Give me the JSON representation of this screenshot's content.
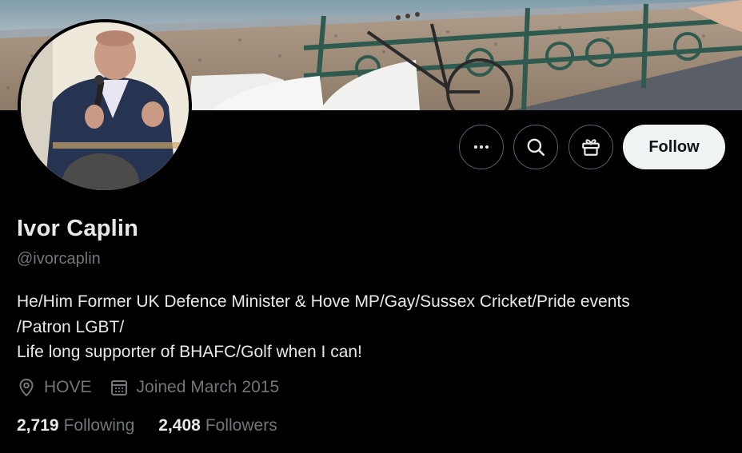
{
  "profile": {
    "name": "Ivor Caplin",
    "handle": "@ivorcaplin",
    "bio_lines": [
      "He/Him Former UK Defence Minister & Hove MP/Gay/Sussex Cricket/Pride events",
      "/Patron LGBT/",
      "Life long supporter of BHAFC/Golf when I can!"
    ],
    "location": "HOVE",
    "joined": "Joined March 2015"
  },
  "stats": {
    "following_count": "2,719",
    "following_label": "Following",
    "followers_count": "2,408",
    "followers_label": "Followers"
  },
  "actions": {
    "follow_label": "Follow",
    "icons": [
      "more-icon",
      "search-icon",
      "gift-icon"
    ]
  },
  "colors": {
    "background": "#000000",
    "primary_text": "#e7e9ea",
    "secondary_text": "#71767b",
    "follow_button_bg": "#eff3f4",
    "border": "#536471"
  }
}
